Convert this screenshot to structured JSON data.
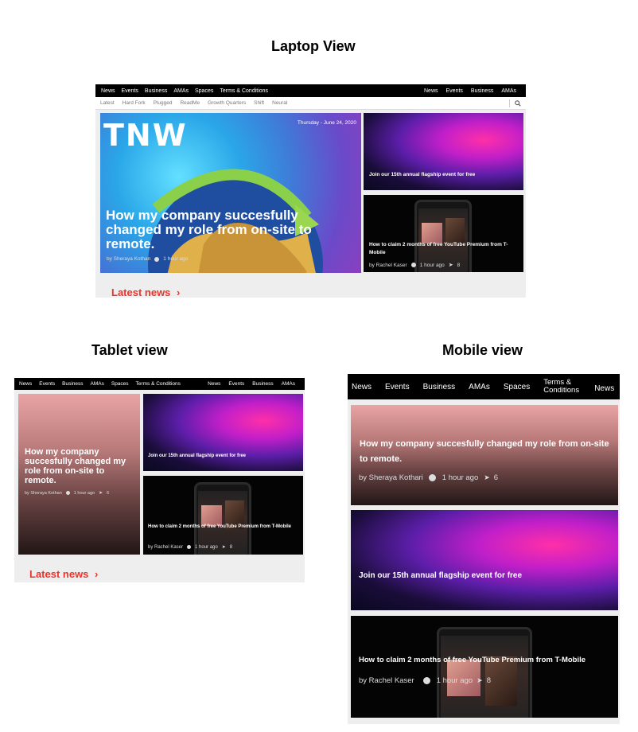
{
  "titles": {
    "laptop": "Laptop View",
    "tablet": "Tablet view",
    "mobile": "Mobile view"
  },
  "nav": {
    "left": [
      "News",
      "Events",
      "Business",
      "AMAs",
      "Spaces",
      "Terms & Conditions"
    ],
    "right": [
      "News",
      "Events",
      "Business",
      "AMAs"
    ]
  },
  "mobile_nav": [
    "News",
    "Events",
    "Business",
    "AMAs",
    "Spaces",
    "Terms & Conditions",
    "News"
  ],
  "subnav": [
    "Latest",
    "Hard Fork",
    "Plugged",
    "ReadMe",
    "Growth Quarters",
    "Shift",
    "Neural"
  ],
  "logo": "TNW",
  "date": "Thursday - June 24, 2020",
  "article_main": {
    "title": "How my company succesfully changed my role from on-site to remote.",
    "author": "by Sheraya Kothari",
    "author_short": "by Sheraya Kothan",
    "time": "1 hour ago",
    "shares": "6"
  },
  "article_event": {
    "title": "Join our 15th annual flagship event for free"
  },
  "article_yt": {
    "title": "How to claim 2 months of free YouTube Premium from T-Mobile",
    "author": "by Rachel Kaser",
    "time": "1 hour ago",
    "shares": "8"
  },
  "latest_news": "Latest news",
  "icons": [
    "search-icon",
    "clock-icon",
    "share-icon",
    "chevron-right-icon"
  ],
  "colors": {
    "accent": "#e8352b",
    "nav_bg": "#000000"
  }
}
